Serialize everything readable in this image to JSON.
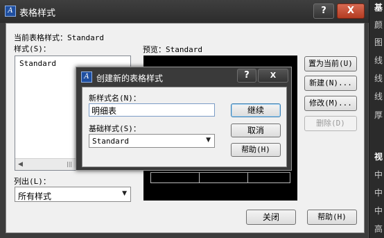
{
  "main": {
    "title": "表格样式",
    "help_btn": "?",
    "close_btn": "X",
    "current_style_label": "当前表格样式：Standard",
    "styles_label": "样式(S)：",
    "styles_list": [
      "Standard"
    ],
    "preview_label": "预览：Standard",
    "list_label": "列出(L)：",
    "list_value": "所有样式",
    "buttons": {
      "set_current": "置为当前(U)",
      "new": "新建(N)...",
      "modify": "修改(M)...",
      "delete": "删除(D)",
      "close": "关闭",
      "help": "帮助(H)"
    }
  },
  "side_panel": [
    "基",
    "颜",
    "图",
    "线",
    "线",
    "线",
    "厚",
    "视",
    "中",
    "中",
    "中",
    "高"
  ],
  "dialog": {
    "title": "创建新的表格样式",
    "help_btn": "?",
    "close_btn": "X",
    "name_label": "新样式名(N)：",
    "name_value": "明细表",
    "base_label": "基础样式(S)：",
    "base_value": "Standard",
    "buttons": {
      "continue": "继续",
      "cancel": "取消",
      "help": "帮助(H)"
    }
  },
  "colors": {
    "title_bar": "#2c2c2c",
    "close_button": "#c04a2e",
    "dialog_bg": "#f0f0f0",
    "preview_bg": "#000000"
  }
}
